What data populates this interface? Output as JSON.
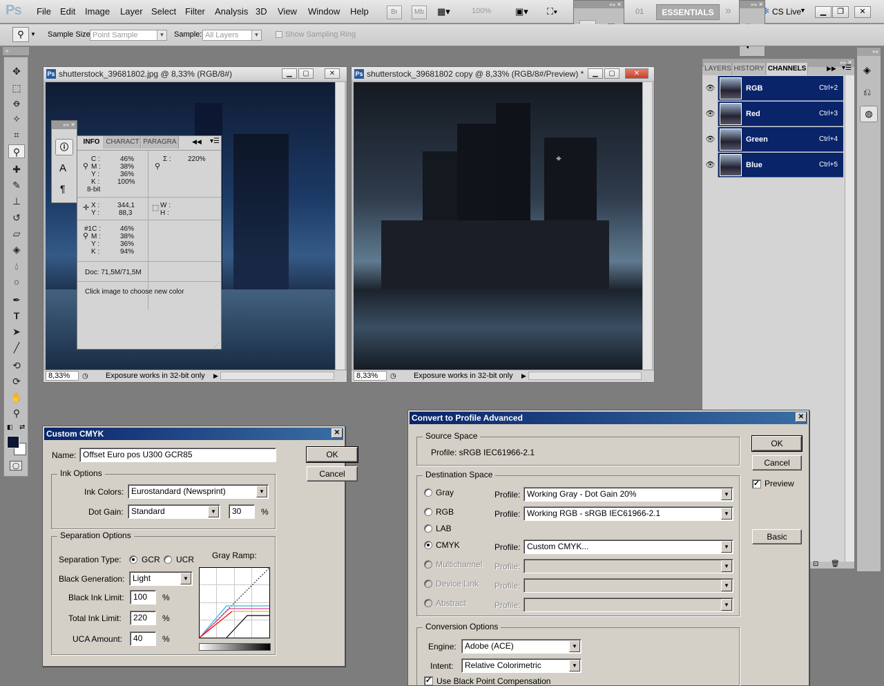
{
  "menubar": {
    "logo": "Ps",
    "items": [
      "File",
      "Edit",
      "Image",
      "Layer",
      "Select",
      "Filter",
      "Analysis",
      "3D",
      "View",
      "Window",
      "Help"
    ],
    "br_label": "Br",
    "mb_label": "Mb",
    "zoom": "100%",
    "workspace_num": "01",
    "workspace": "ESSENTIALS",
    "cslive": "CS Live"
  },
  "options": {
    "sample_size_label": "Sample Size:",
    "sample_size_value": "Point Sample",
    "sample_label": "Sample:",
    "sample_value": "All Layers",
    "ring_label": "Show Sampling Ring"
  },
  "doc1": {
    "title": "shutterstock_39681802.jpg @ 8,33% (RGB/8#)",
    "zoom": "8,33%",
    "status": "Exposure works in 32-bit only"
  },
  "doc2": {
    "title": "shutterstock_39681802 copy @ 8,33% (RGB/8#/Preview) *",
    "zoom": "8,33%",
    "status": "Exposure works in 32-bit only"
  },
  "info": {
    "tabs": [
      "INFO",
      "CHARACT",
      "PARAGRA"
    ],
    "c_label": "C :",
    "c": "46%",
    "m_label": "M :",
    "m": "38%",
    "y_label": "Y :",
    "y": "36%",
    "k_label": "K :",
    "k": "100%",
    "bit": "8-bit",
    "sigma_label": "Σ :",
    "sigma": "220%",
    "x_label": "X :",
    "x": "344,1",
    "y2_label": "Y :",
    "y2": "88,3",
    "w_label": "W :",
    "h_label": "H :",
    "s_c_label": "#1C :",
    "s_c": "46%",
    "s_m_label": "M :",
    "s_m": "38%",
    "s_y_label": "Y :",
    "s_y": "36%",
    "s_k_label": "K :",
    "s_k": "94%",
    "doc": "Doc: 71,5M/71,5M",
    "hint": "Click image to choose new color"
  },
  "channels": {
    "tabs": [
      "LAYERS",
      "HISTORY",
      "CHANNELS"
    ],
    "rows": [
      {
        "name": "RGB",
        "shortcut": "Ctrl+2"
      },
      {
        "name": "Red",
        "shortcut": "Ctrl+3"
      },
      {
        "name": "Green",
        "shortcut": "Ctrl+4"
      },
      {
        "name": "Blue",
        "shortcut": "Ctrl+5"
      }
    ]
  },
  "custom_cmyk": {
    "title": "Custom CMYK",
    "name_label": "Name:",
    "name_value": "Offset Euro pos U300 GCR85",
    "ok": "OK",
    "cancel": "Cancel",
    "ink_options": "Ink Options",
    "ink_colors_label": "Ink Colors:",
    "ink_colors_value": "Eurostandard (Newsprint)",
    "dot_gain_label": "Dot Gain:",
    "dot_gain_value": "Standard",
    "dot_gain_num": "30",
    "pct": "%",
    "separation_options": "Separation Options",
    "separation_type_label": "Separation Type:",
    "gcr": "GCR",
    "ucr": "UCR",
    "gray_ramp": "Gray Ramp:",
    "black_gen_label": "Black Generation:",
    "black_gen_value": "Light",
    "black_ink_label": "Black Ink Limit:",
    "black_ink_value": "100",
    "total_ink_label": "Total Ink Limit:",
    "total_ink_value": "220",
    "uca_label": "UCA Amount:",
    "uca_value": "40"
  },
  "convert": {
    "title": "Convert to Profile Advanced",
    "source_space": "Source Space",
    "source_profile": "Profile:  sRGB IEC61966-2.1",
    "ok": "OK",
    "cancel": "Cancel",
    "preview": "Preview",
    "basic": "Basic",
    "destination_space": "Destination Space",
    "profile_label": "Profile:",
    "gray": "Gray",
    "gray_profile": "Working Gray - Dot Gain 20%",
    "rgb": "RGB",
    "rgb_profile": "Working RGB - sRGB IEC61966-2.1",
    "lab": "LAB",
    "cmyk": "CMYK",
    "cmyk_profile": "Custom CMYK...",
    "multichannel": "Multichannel",
    "device_link": "Device Link",
    "abstract": "Abstract",
    "conversion_options": "Conversion Options",
    "engine_label": "Engine:",
    "engine_value": "Adobe (ACE)",
    "intent_label": "Intent:",
    "intent_value": "Relative Colorimetric",
    "bpc": "Use Black Point Compensation"
  },
  "colors": {
    "title_bar": "#0a246a",
    "dialog_face": "#d4d0c8",
    "channel_selected": "#0a246a",
    "workspace_bg": "#7d7d7d"
  }
}
